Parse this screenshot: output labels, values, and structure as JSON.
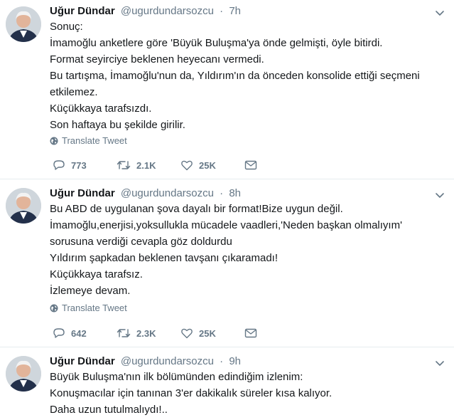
{
  "tweets": [
    {
      "name": "Uğur Dündar",
      "handle": "@ugurdundarsozcu",
      "dot": "·",
      "time": "7h",
      "lines": [
        "Sonuç:",
        "İmamoğlu anketlere göre 'Büyük Buluşma'ya önde gelmişti, öyle bitirdi.",
        "Format seyirciye beklenen heyecanı vermedi.",
        "Bu tartışma, İmamoğlu'nun da, Yıldırım'ın da önceden konsolide ettiği seçmeni",
        "etkilemez.",
        "Küçükkaya tarafsızdı.",
        "Son haftaya bu şekilde girilir."
      ],
      "translate": "Translate Tweet",
      "replies": "773",
      "retweets": "2.1K",
      "likes": "25K"
    },
    {
      "name": "Uğur Dündar",
      "handle": "@ugurdundarsozcu",
      "dot": "·",
      "time": "8h",
      "lines": [
        "Bu ABD de uygulanan şova dayalı bir format!Bize uygun değil.",
        "İmamoğlu,enerjisi,yoksullukla mücadele vaadleri,'Neden başkan olmalıyım'",
        "sorusuna verdiği cevapla göz doldurdu",
        "Yıldırım şapkadan beklenen tavşanı çıkaramadı!",
        "Küçükkaya tarafsız.",
        "İzlemeye devam."
      ],
      "translate": "Translate Tweet",
      "replies": "642",
      "retweets": "2.3K",
      "likes": "25K"
    },
    {
      "name": "Uğur Dündar",
      "handle": "@ugurdundarsozcu",
      "dot": "·",
      "time": "9h",
      "lines": [
        "Büyük Buluşma'nın ilk bölümünden edindiğim izlenim:",
        "Konuşmacılar için tanınan 3'er dakikalık süreler kısa kalıyor.",
        "Daha uzun tutulmalıydı!.."
      ]
    }
  ],
  "colors": {
    "text": "#14171a",
    "secondary": "#657786",
    "divider": "#e6ecf0"
  },
  "icons": [
    "chevron-down-icon",
    "globe-icon",
    "reply-icon",
    "retweet-icon",
    "like-icon",
    "message-icon"
  ]
}
